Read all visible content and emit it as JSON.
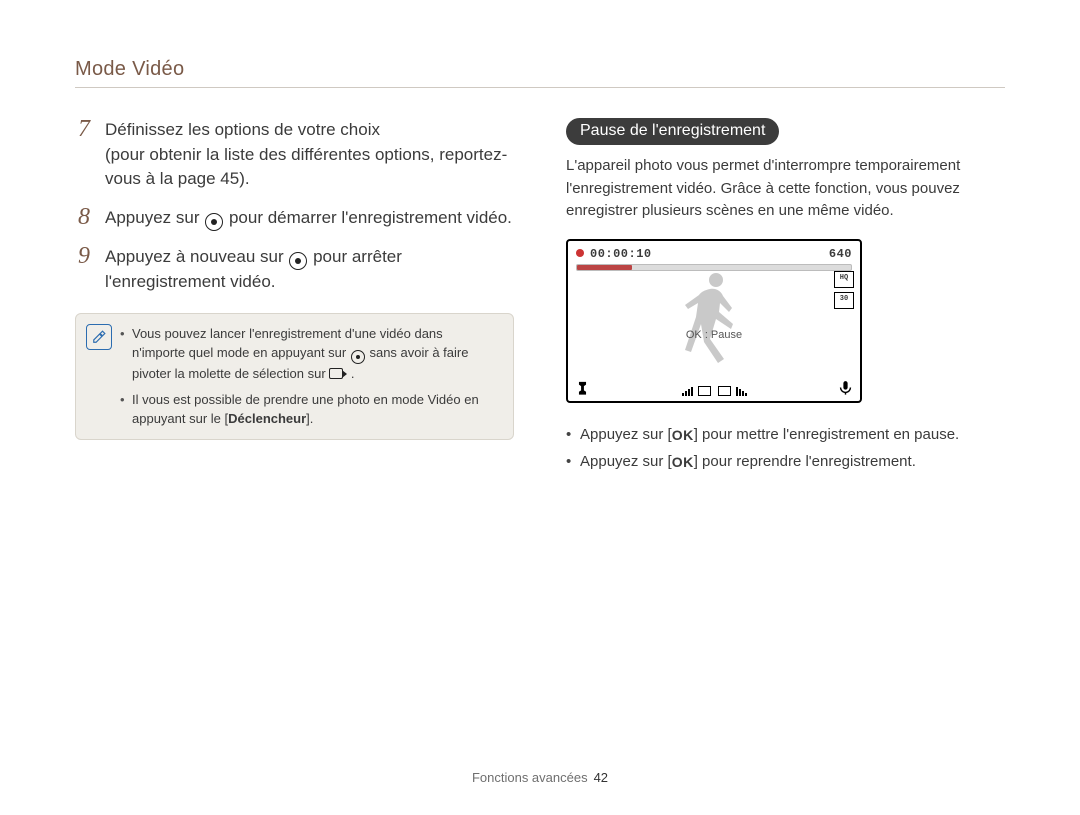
{
  "header": "Mode Vidéo",
  "steps": [
    {
      "num": "7",
      "text_before": "Définissez les options de votre choix",
      "text_after": "(pour obtenir la liste des différentes options, reportez-vous à la page 45)."
    },
    {
      "num": "8",
      "text_before": "Appuyez sur ",
      "icon": "rec",
      "text_after": " pour démarrer l'enregistrement vidéo."
    },
    {
      "num": "9",
      "text_before": "Appuyez à nouveau sur ",
      "icon": "rec",
      "text_after": " pour arrêter l'enregistrement vidéo."
    }
  ],
  "note": {
    "items": [
      {
        "before": "Vous pouvez lancer l'enregistrement d'une vidéo dans n'importe quel mode en appuyant sur ",
        "icon": "rec",
        "mid": " sans avoir à faire pivoter la molette de sélection sur ",
        "icon2": "video",
        "after": "."
      },
      {
        "before": "Il vous est possible de prendre une photo en mode Vidéo en appuyant sur le [",
        "bold": "Déclencheur",
        "after": "]."
      }
    ]
  },
  "right": {
    "pill": "Pause de l'enregistrement",
    "intro": "L'appareil photo vous permet d'interrompre temporairement l'enregistrement vidéo. Grâce à cette fonction, vous pouvez enregistrer plusieurs scènes en une même vidéo.",
    "lcd": {
      "timer": "00:00:10",
      "res": "640",
      "ok": "OK : Pause",
      "q1": "HQ",
      "fps": "30"
    },
    "bullets": [
      {
        "before": "Appuyez sur [",
        "btn": "OK",
        "after": "] pour mettre l'enregistrement en pause."
      },
      {
        "before": "Appuyez sur [",
        "btn": "OK",
        "after": "] pour reprendre l'enregistrement."
      }
    ]
  },
  "footer": {
    "section": "Fonctions avancées",
    "page": "42"
  }
}
